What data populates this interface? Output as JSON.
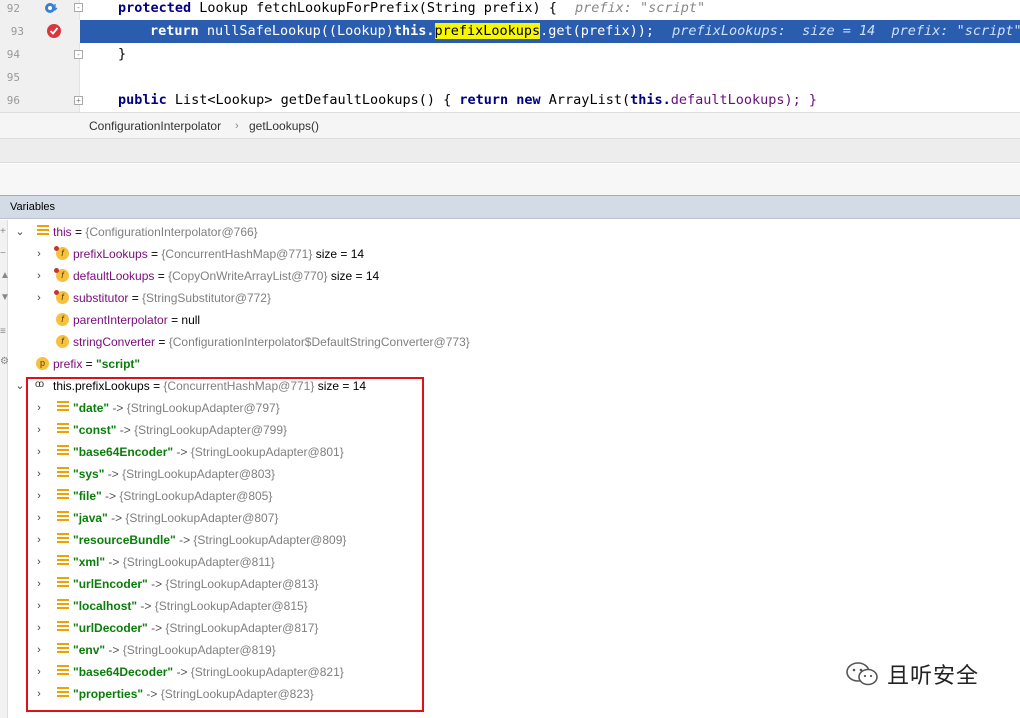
{
  "editor": {
    "lines": [
      {
        "num": "92",
        "kw1": "protected",
        "text": " Lookup fetchLookupForPrefix(String prefix) { ",
        "hint": "prefix: \"script\""
      },
      {
        "num": "93",
        "kw1": "return",
        "pre": " nullSafeLookup((Lookup)",
        "kw2": "this.",
        "highlight": "prefixLookups",
        "post": ".get(prefix)); ",
        "hint": "prefixLookups:  size = 14  prefix: \"script\""
      },
      {
        "num": "94",
        "text": "}"
      },
      {
        "num": "95",
        "text": ""
      },
      {
        "num": "96",
        "kw1": "public",
        "pre": " List<Lookup> getDefaultLookups() { ",
        "kw2": "return new",
        "mid": " ArrayList(",
        "kw3": "this.",
        "post": "defaultLookups); }"
      }
    ]
  },
  "breadcrumb": {
    "items": [
      "ConfigurationInterpolator",
      "getLookups()"
    ],
    "separator": "›"
  },
  "variables": {
    "panel_title": "Variables",
    "this_row": {
      "name": "this",
      "eq": " = ",
      "value": "{ConfigurationInterpolator@766}"
    },
    "fields": [
      {
        "name": "prefixLookups",
        "value": "{ConcurrentHashMap@771}",
        "extra": "size = 14",
        "expandable": true
      },
      {
        "name": "defaultLookups",
        "value": "{CopyOnWriteArrayList@770}",
        "extra": "size = 14",
        "expandable": true
      },
      {
        "name": "substitutor",
        "value": "{StringSubstitutor@772}",
        "extra": "",
        "expandable": true
      },
      {
        "name": "parentInterpolator",
        "value": "",
        "null_value": "null",
        "extra": "",
        "expandable": false
      },
      {
        "name": "stringConverter",
        "value": "{ConfigurationInterpolator$DefaultStringConverter@773}",
        "extra": "",
        "expandable": false
      }
    ],
    "prefix_row": {
      "name": "prefix",
      "eq": " = ",
      "value": "\"script\""
    },
    "map_row": {
      "name": "this.prefixLookups",
      "eq": " = ",
      "value": "{ConcurrentHashMap@771}",
      "extra": "size = 14"
    },
    "entries": [
      {
        "key": "\"date\"",
        "value": "{StringLookupAdapter@797}"
      },
      {
        "key": "\"const\"",
        "value": "{StringLookupAdapter@799}"
      },
      {
        "key": "\"base64Encoder\"",
        "value": "{StringLookupAdapter@801}"
      },
      {
        "key": "\"sys\"",
        "value": "{StringLookupAdapter@803}"
      },
      {
        "key": "\"file\"",
        "value": "{StringLookupAdapter@805}"
      },
      {
        "key": "\"java\"",
        "value": "{StringLookupAdapter@807}"
      },
      {
        "key": "\"resourceBundle\"",
        "value": "{StringLookupAdapter@809}"
      },
      {
        "key": "\"xml\"",
        "value": "{StringLookupAdapter@811}"
      },
      {
        "key": "\"urlEncoder\"",
        "value": "{StringLookupAdapter@813}"
      },
      {
        "key": "\"localhost\"",
        "value": "{StringLookupAdapter@815}"
      },
      {
        "key": "\"urlDecoder\"",
        "value": "{StringLookupAdapter@817}"
      },
      {
        "key": "\"env\"",
        "value": "{StringLookupAdapter@819}"
      },
      {
        "key": "\"base64Decoder\"",
        "value": "{StringLookupAdapter@821}"
      },
      {
        "key": "\"properties\"",
        "value": "{StringLookupAdapter@823}"
      }
    ],
    "arrow_op": " -> "
  },
  "watermark": {
    "text": "且听安全"
  },
  "icons": {
    "breakpoint": "breakpoint-icon",
    "field": "field-icon",
    "parameter": "parameter-icon",
    "watch": "watch-icon",
    "object": "object-icon"
  },
  "colors": {
    "current_line": "#2a5db0",
    "search_highlight": "#f7f700",
    "annotation_box": "#e0101a",
    "string_value": "#0a7d0a"
  }
}
